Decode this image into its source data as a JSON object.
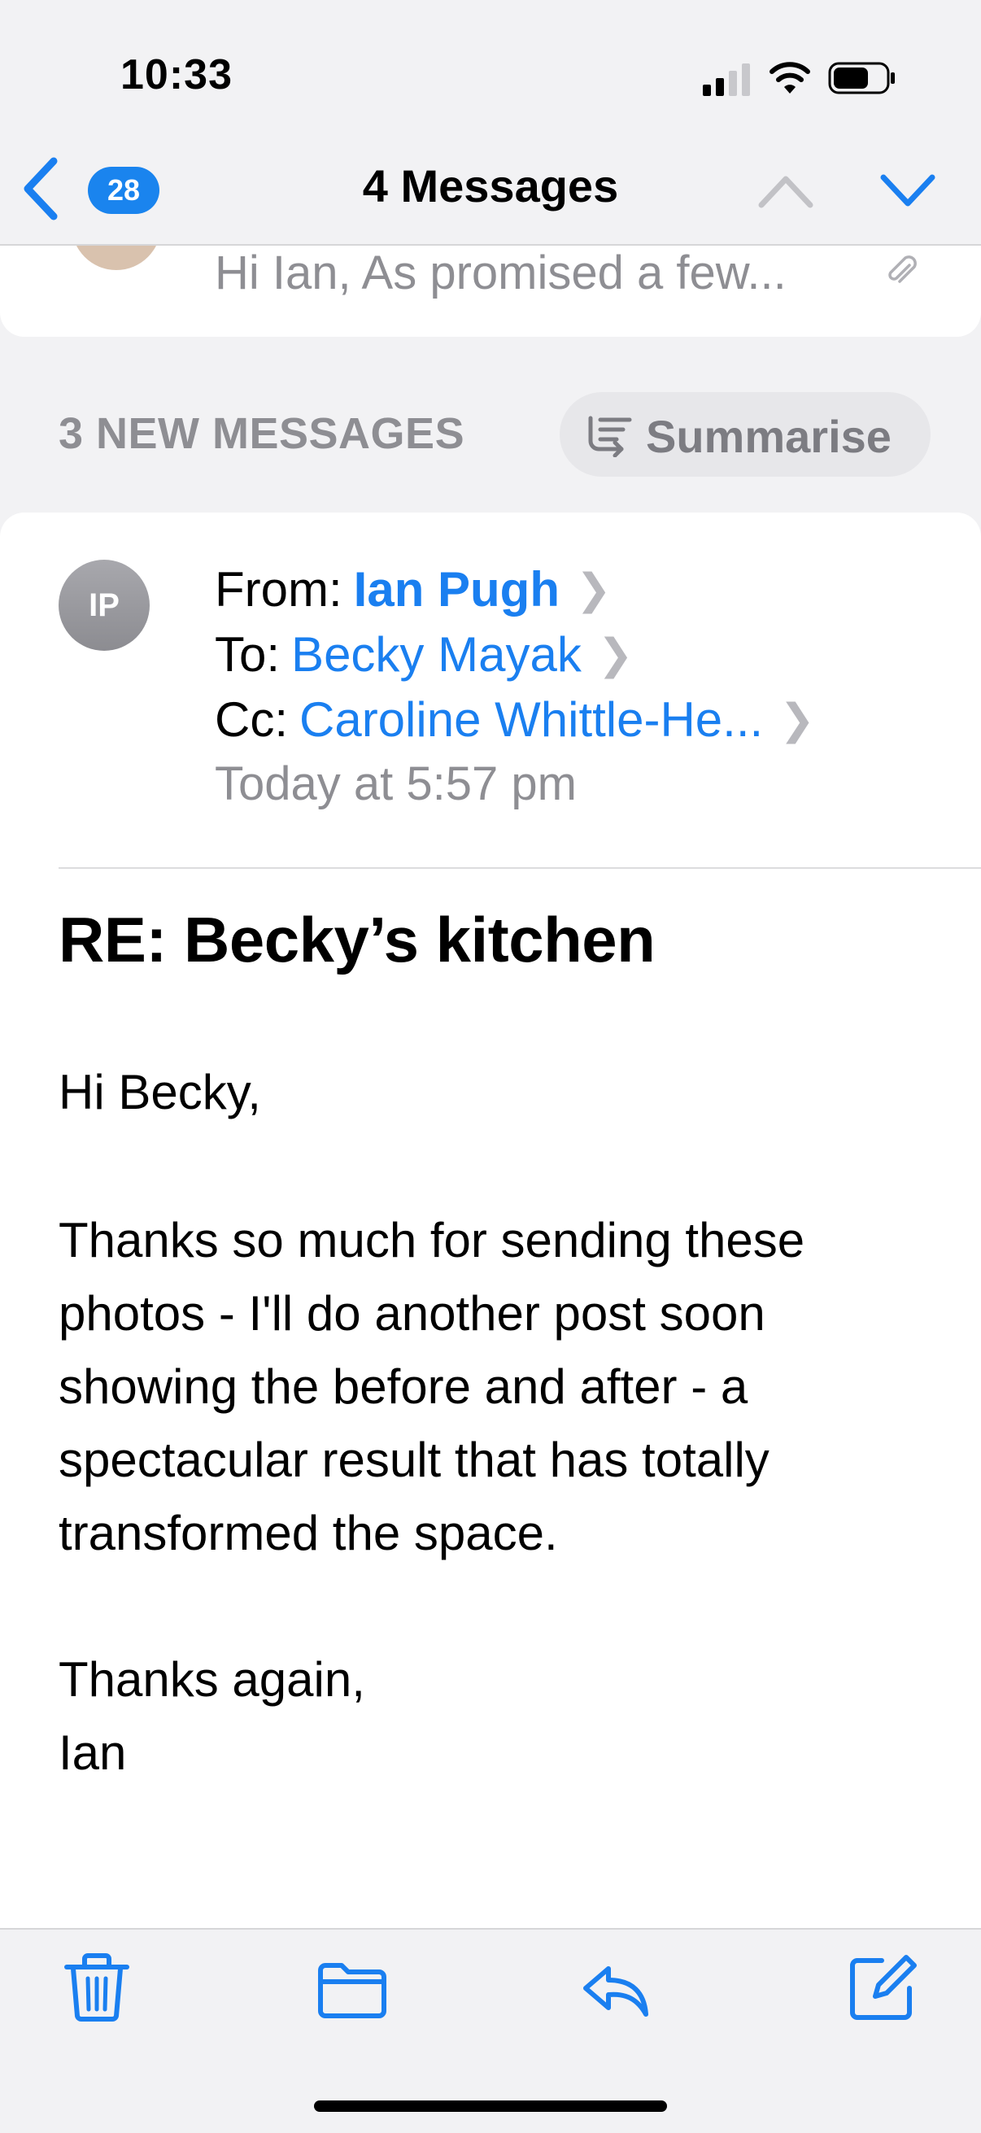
{
  "status_bar": {
    "time": "10:33"
  },
  "nav": {
    "unread_count": "28",
    "title": "4 Messages"
  },
  "previous_message": {
    "snippet": "Hi Ian, As promised a few..."
  },
  "new_messages": {
    "label": "3 NEW MESSAGES",
    "summarise_label": "Summarise"
  },
  "message": {
    "avatar_initials": "IP",
    "from_label": "From:",
    "from_name": "Ian Pugh",
    "to_label": "To:",
    "to_name": "Becky Mayak",
    "cc_label": "Cc:",
    "cc_name": "Caroline Whittle-He...",
    "date": "Today at 5:57 pm",
    "subject": "RE: Becky’s kitchen",
    "greeting": "Hi Becky,",
    "paragraph": "Thanks so much for sending these photos - I'll do another post soon showing the before and after - a spectacular result that has totally transformed the space.",
    "signoff_line1": "Thanks again,",
    "signoff_line2": "Ian"
  },
  "toolbar": {
    "icons": [
      "trash-icon",
      "folder-icon",
      "reply-icon",
      "compose-icon"
    ]
  },
  "colors": {
    "accent": "#1a7ff0",
    "badge": "#1a84ee",
    "secondary_text": "#8e8e93",
    "background": "#f2f2f4"
  }
}
